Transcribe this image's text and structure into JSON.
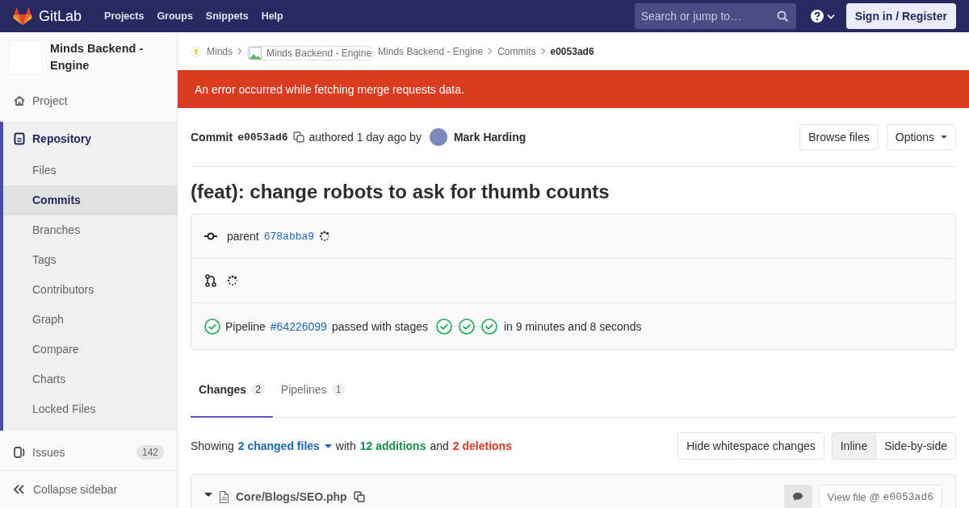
{
  "header": {
    "logo": "GitLab",
    "nav": [
      {
        "label": "Projects"
      },
      {
        "label": "Groups"
      },
      {
        "label": "Snippets"
      },
      {
        "label": "Help"
      }
    ],
    "search": {
      "placeholder": "Search or jump to…"
    },
    "sign_in": "Sign in / Register"
  },
  "sidebar": {
    "project_name": "Minds Backend - Engine",
    "items": [
      {
        "label": "Project",
        "kind": "home",
        "selected": false
      },
      {
        "label": "Repository",
        "kind": "repo",
        "selected": true,
        "children": [
          {
            "label": "Files",
            "selected": false
          },
          {
            "label": "Commits",
            "selected": true
          },
          {
            "label": "Branches",
            "selected": false
          },
          {
            "label": "Tags",
            "selected": false
          },
          {
            "label": "Contributors",
            "selected": false
          },
          {
            "label": "Graph",
            "selected": false
          },
          {
            "label": "Compare",
            "selected": false
          },
          {
            "label": "Charts",
            "selected": false
          },
          {
            "label": "Locked Files",
            "selected": false
          }
        ]
      },
      {
        "label": "Issues",
        "kind": "issues",
        "count": "142",
        "selected": false
      }
    ],
    "collapse": "Collapse sidebar"
  },
  "breadcrumbs": [
    {
      "label": "Minds",
      "kind": "group"
    },
    {
      "label": "Minds Backend - Engine",
      "kind": "image-alt"
    },
    {
      "label": "Minds Backend - Engine",
      "kind": "link"
    },
    {
      "label": "Commits",
      "kind": "link"
    },
    {
      "label": "e0053ad6",
      "kind": "current"
    }
  ],
  "alert": "An error occurred while fetching merge requests data.",
  "commit": {
    "label": "Commit",
    "sha": "e0053ad6",
    "authored": "authored 1 day ago by",
    "author": "Mark Harding",
    "browse": "Browse files",
    "options": "Options",
    "title": "(feat): change robots to ask for thumb counts",
    "parent_label": "parent",
    "parent_sha": "678abba9",
    "pipeline": {
      "label": "Pipeline",
      "id": "#64226099",
      "text": "passed with stages",
      "passed": true,
      "stages": [
        {
          "passed": true
        },
        {
          "passed": true
        },
        {
          "passed": true
        }
      ],
      "duration": "in 9 minutes and 8 seconds"
    }
  },
  "tabs": [
    {
      "label": "Changes",
      "count": "2",
      "selected": true
    },
    {
      "label": "Pipelines",
      "count": "1",
      "selected": false
    }
  ],
  "summary": {
    "showing": "Showing",
    "files": "2 changed files",
    "with": "with",
    "additions": "12 additions",
    "and": "and",
    "deletions": "2 deletions",
    "whitespace": "Hide whitespace changes",
    "view_modes": [
      {
        "label": "Inline",
        "selected": true
      },
      {
        "label": "Side-by-side",
        "selected": false
      }
    ]
  },
  "file": {
    "path": "Core/Blogs/SEO.php",
    "expanded": true,
    "view_file": "View file @",
    "sha": "e0053ad6"
  }
}
